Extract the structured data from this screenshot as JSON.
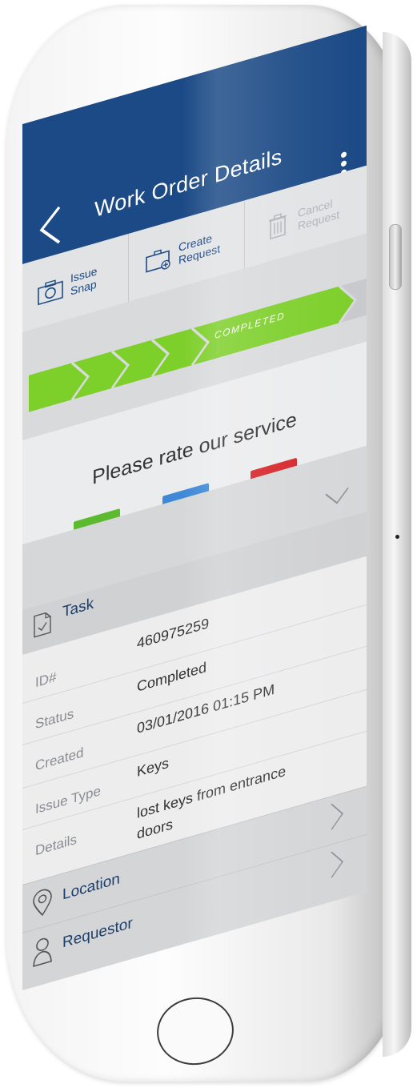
{
  "header": {
    "title": "Work Order Details"
  },
  "toolbar": {
    "issue_snap": [
      "Issue",
      "Snap"
    ],
    "create_request": [
      "Create",
      "Request"
    ],
    "cancel_request": [
      "Cancel",
      "Request"
    ]
  },
  "progress": {
    "status_label": "COMPLETED"
  },
  "rating": {
    "prompt": "Please rate our service"
  },
  "task": {
    "heading": "Task",
    "fields": [
      {
        "label": "ID#",
        "value": "460975259"
      },
      {
        "label": "Status",
        "value": "Completed"
      },
      {
        "label": "Created",
        "value": "03/01/2016 01:15 PM"
      },
      {
        "label": "Issue Type",
        "value": "Keys"
      },
      {
        "label": "Details",
        "value": "lost keys from entrance doors"
      }
    ]
  },
  "sections": {
    "location": "Location",
    "requestor": "Requestor"
  },
  "colors": {
    "primary": "#1c4a86",
    "progress_green": "#7dcf2a",
    "thumbs_up": "#5cba2f",
    "neutral": "#3e88d6",
    "thumbs_down": "#d6252a"
  }
}
